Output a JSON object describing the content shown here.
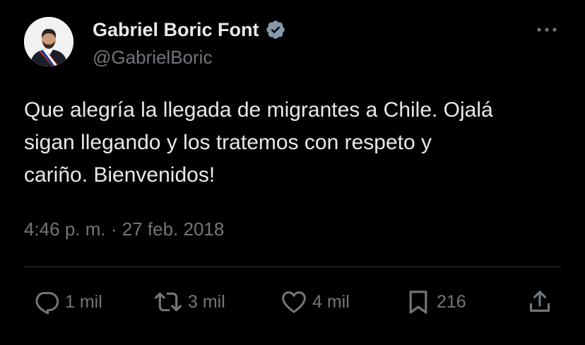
{
  "author": {
    "display_name": "Gabriel Boric Font",
    "handle": "@GabrielBoric",
    "verified_icon": "verified-badge-icon"
  },
  "tweet": {
    "text": "Que alegría la llegada de migrantes a Chile. Ojalá\nsigan llegando y los tratemos con respeto y\ncariño. Bienvenidos!",
    "time": "4:46 p. m.",
    "separator": "·",
    "date": "27 feb. 2018"
  },
  "actions": {
    "reply": {
      "icon": "reply-icon",
      "count": "1 mil"
    },
    "retweet": {
      "icon": "retweet-icon",
      "count": "3 mil"
    },
    "like": {
      "icon": "heart-icon",
      "count": "4 mil"
    },
    "bookmark": {
      "icon": "bookmark-icon",
      "count": "216"
    },
    "share": {
      "icon": "share-icon"
    }
  },
  "colors": {
    "background": "#000000",
    "primary_text": "#e7e9ea",
    "secondary_text": "#71767b",
    "divider": "#2f3336",
    "verified_badge": "#829aab"
  }
}
